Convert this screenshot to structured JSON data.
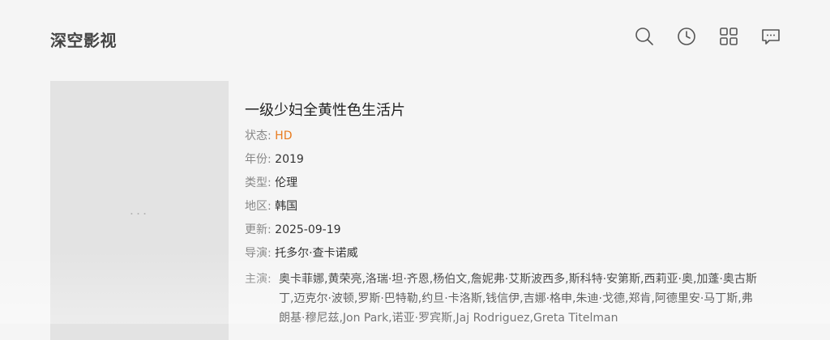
{
  "site": {
    "logo": "深空影视"
  },
  "header": {
    "icons": [
      "search-icon",
      "history-icon",
      "grid-icon",
      "message-icon"
    ]
  },
  "colors": {
    "accent": "#e87a1d",
    "background": "#f5f5f5",
    "poster_placeholder": "#e3e3e3"
  },
  "movie": {
    "poster_placeholder": "...",
    "title": "一级少妇全黄性色生活片",
    "status_label": "状态:",
    "status": "HD",
    "year_label": "年份:",
    "year": "2019",
    "genre_label": "类型:",
    "genre": "伦理",
    "region_label": "地区:",
    "region": "韩国",
    "updated_label": "更新:",
    "updated": "2025-09-19",
    "director_label": "导演:",
    "director": "托多尔·查卡诺威",
    "cast_label": "主演:",
    "cast": "奥卡菲娜,黄荣亮,洛瑞·坦·齐恩,杨伯文,詹妮弗·艾斯波西多,斯科特·安第斯,西莉亚·奥,加蓬·奥古斯丁,迈克尔·波顿,罗斯·巴特勒,约旦·卡洛斯,钱信伊,吉娜·格申,朱迪·戈德,郑肯,阿德里安·马丁斯,弗朗基·穆尼兹,Jon Park,诺亚·罗宾斯,Jaj Rodriguez,Greta Titelman"
  }
}
